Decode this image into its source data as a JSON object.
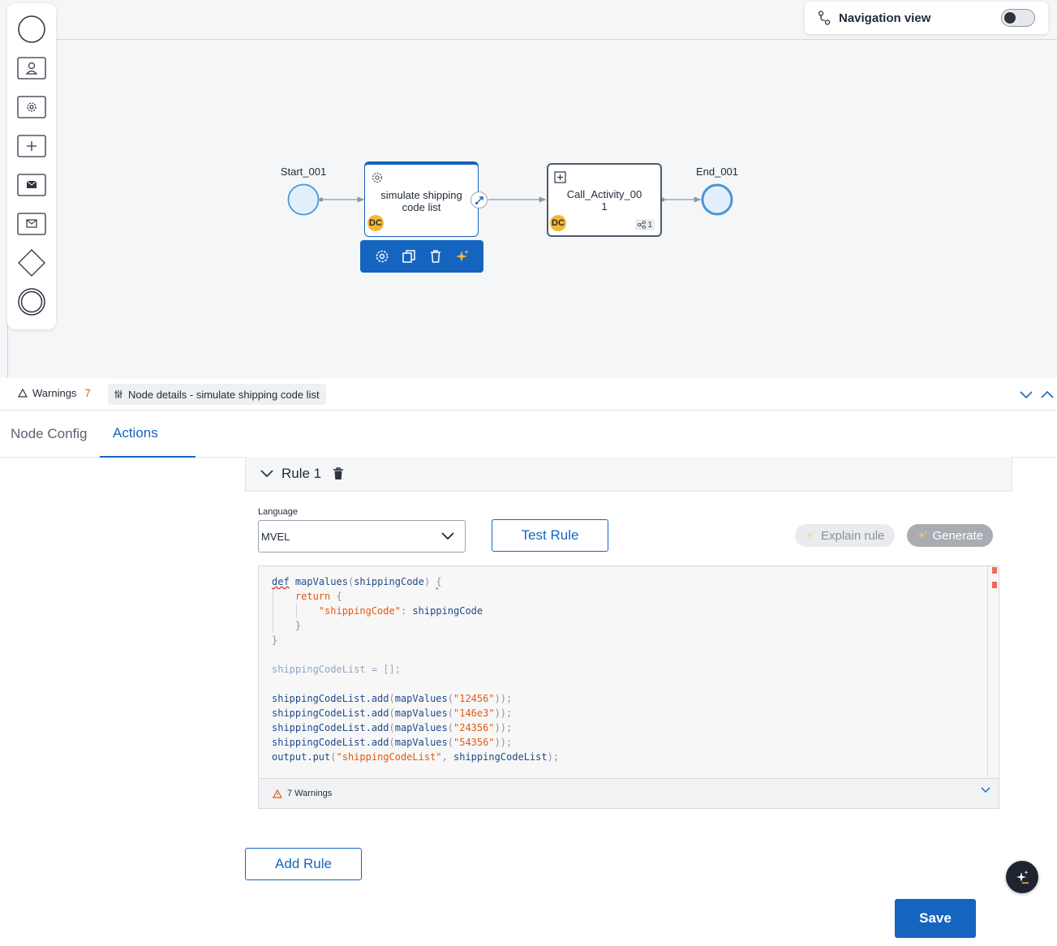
{
  "navigation_view": {
    "label": "Navigation view",
    "enabled": false
  },
  "palette": {
    "items": [
      "start-event",
      "user-task",
      "service-task",
      "subprocess",
      "send-message",
      "receive-message",
      "gateway",
      "end-event"
    ]
  },
  "diagram": {
    "start": {
      "label": "Start_001"
    },
    "task": {
      "title": "simulate shipping code list",
      "badge": "DC"
    },
    "call_activity": {
      "title": "Call_Activity_001",
      "badge": "DC",
      "count": "1"
    },
    "end": {
      "label": "End_001"
    }
  },
  "panel": {
    "warnings_label": "Warnings",
    "warnings_count": "7",
    "node_details_label": "Node details - simulate shipping code list"
  },
  "tabs": [
    {
      "label": "Node Config",
      "active": false
    },
    {
      "label": "Actions",
      "active": true
    }
  ],
  "rule": {
    "title": "Rule 1",
    "language_label": "Language",
    "language_value": "MVEL",
    "test_button": "Test Rule",
    "explain_button": "Explain rule",
    "generate_button": "Generate",
    "footer_warnings": "7 Warnings"
  },
  "buttons": {
    "add_rule": "Add Rule",
    "save": "Save"
  },
  "colors": {
    "primary": "#1565c0",
    "warning": "#e8590c",
    "badge": "#f5b731"
  }
}
